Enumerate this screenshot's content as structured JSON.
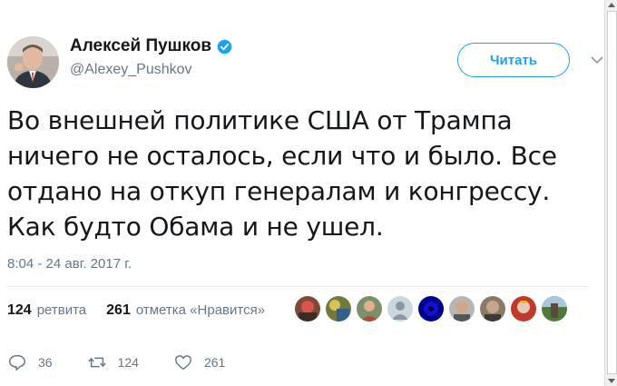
{
  "author": {
    "name": "Алексей Пушков",
    "handle": "@Alexey_Pushkov",
    "verified": true
  },
  "follow_button": {
    "label": "Читать"
  },
  "tweet": {
    "lines": [
      "Во внешней политике США от Трампа",
      "ничего не осталось, если что и было. Все",
      "отдано на откуп генералам и конгрессу.",
      "Как будто Обама и не ушел."
    ],
    "timestamp": "8:04 - 24 авг. 2017 г."
  },
  "stats": {
    "retweets_count": "124",
    "retweets_label": "ретвита",
    "likes_count": "261",
    "likes_label": "отметка «Нравится»",
    "liker_avatars": 9
  },
  "actions": {
    "replies": "36",
    "retweets": "124",
    "likes": "261"
  },
  "colors": {
    "accent": "#1da1f2",
    "secondary_text": "#657786",
    "divider": "#e6ecf0"
  }
}
